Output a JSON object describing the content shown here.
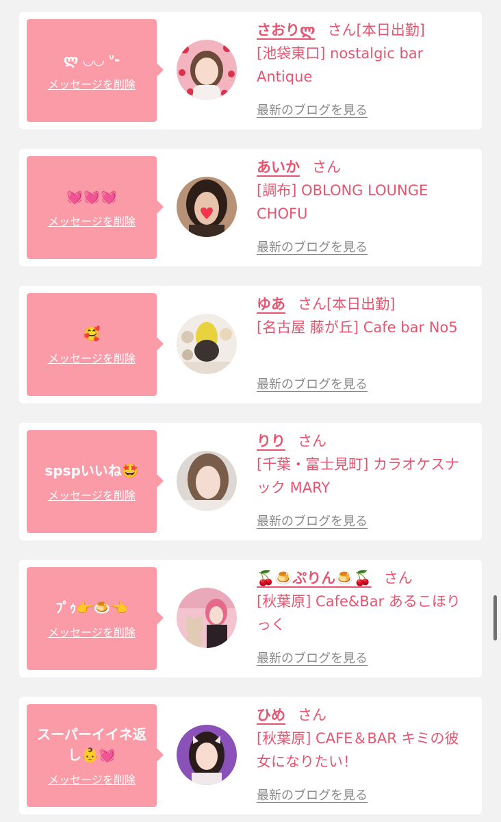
{
  "messages": [
    {
      "bubble_text": "ლ ◡◡ ᐡ-",
      "delete_label": "メッセージを削除",
      "name": "さおりლ",
      "honorific": "さん[本日出勤]",
      "shop": "[池袋東口] nostalgic bar Antique",
      "blog_label": "最新のブログを見る",
      "avatar_icon": "avatar-photo-icon"
    },
    {
      "bubble_text": "💓💓💓",
      "delete_label": "メッセージを削除",
      "name": "あいか",
      "honorific": "さん",
      "shop": "[調布] OBLONG LOUNGE CHOFU",
      "blog_label": "最新のブログを見る",
      "avatar_icon": "avatar-photo-icon"
    },
    {
      "bubble_text": "🥰",
      "delete_label": "メッセージを削除",
      "name": "ゆあ",
      "honorific": "さん[本日出勤]",
      "shop": "[名古屋 藤が丘] Cafe bar No5",
      "blog_label": "最新のブログを見る",
      "avatar_icon": "avatar-photo-icon"
    },
    {
      "bubble_text": "spspいいね🤩",
      "delete_label": "メッセージを削除",
      "name": "りり",
      "honorific": "さん",
      "shop": "[千葉・富士見町] カラオケスナック MARY",
      "blog_label": "最新のブログを見る",
      "avatar_icon": "avatar-photo-icon"
    },
    {
      "bubble_text": "ﾌﾟｩ👉🍮👈",
      "delete_label": "メッセージを削除",
      "name": "🍒🍮ぷりん🍮🍒",
      "honorific": "さん",
      "shop": "[秋葉原] Cafe&Bar あるこほりっく",
      "blog_label": "最新のブログを見る",
      "avatar_icon": "avatar-photo-icon"
    },
    {
      "bubble_text": "スーパーイイネ返し👶💓",
      "delete_label": "メッセージを削除",
      "name": "ひめ",
      "honorific": "さん",
      "shop": "[秋葉原] CAFE＆BAR キミの彼女になりたい！",
      "blog_label": "最新のブログを見る",
      "avatar_icon": "avatar-photo-icon"
    }
  ],
  "colors": {
    "accent_pink": "#e8546f",
    "bubble_pink": "#fc9ba8",
    "page_background": "#f2f2f2",
    "card_background": "#ffffff",
    "link_gray": "#888888"
  }
}
